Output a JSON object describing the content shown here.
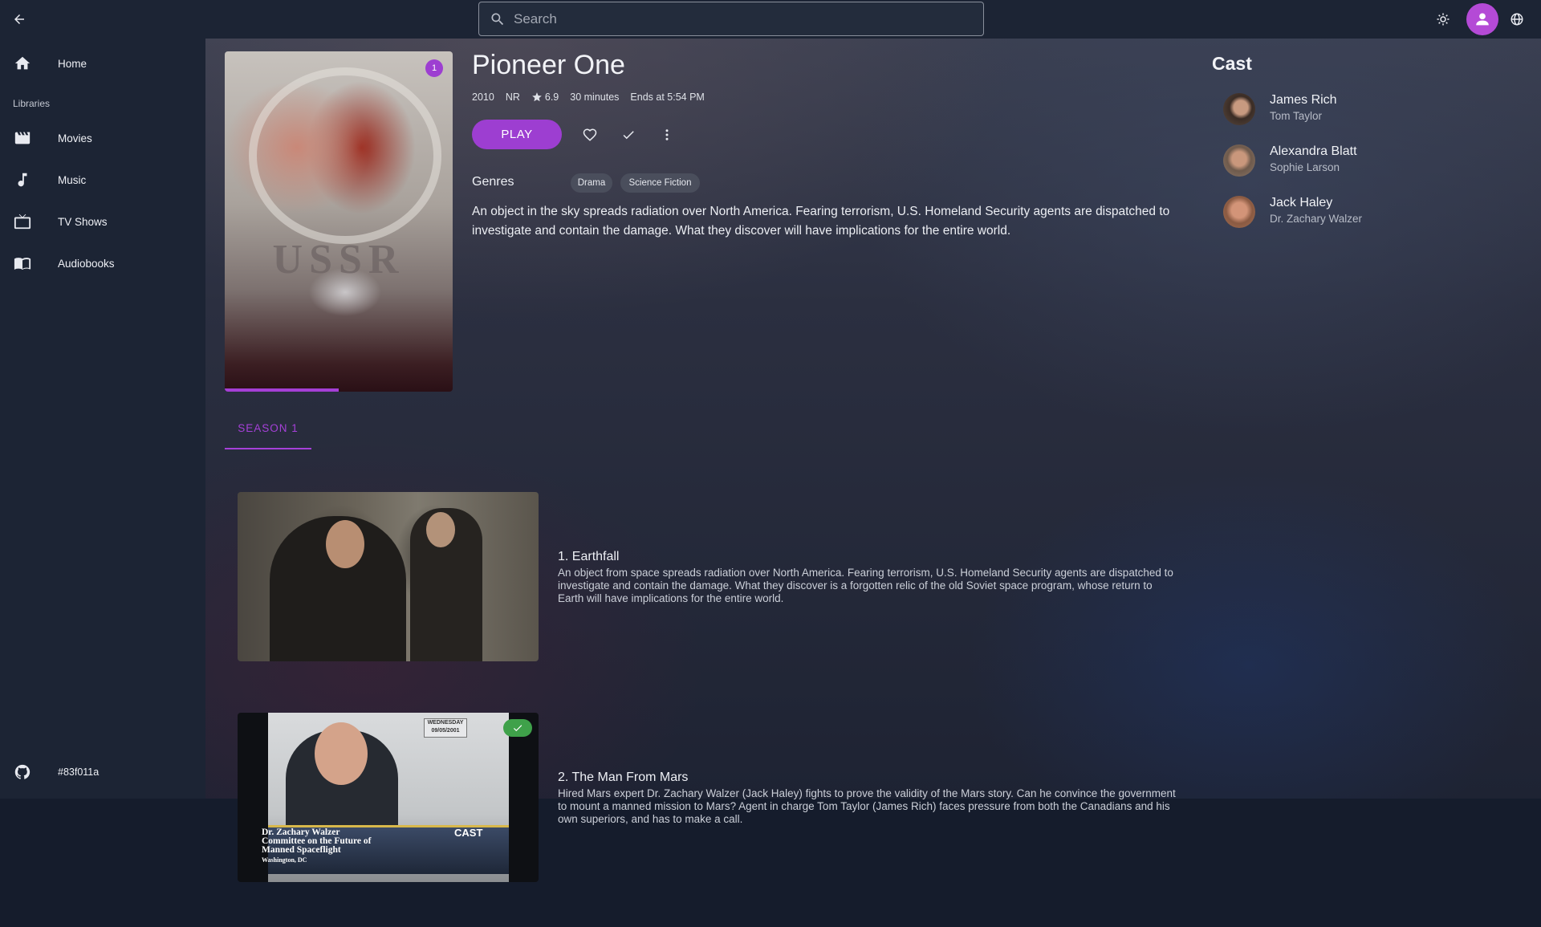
{
  "search": {
    "placeholder": "Search"
  },
  "sidebar": {
    "items": [
      {
        "label": "Home",
        "icon": "home-icon"
      },
      {
        "label": "Movies",
        "icon": "movie-icon"
      },
      {
        "label": "Music",
        "icon": "music-icon"
      },
      {
        "label": "TV Shows",
        "icon": "tv-icon"
      },
      {
        "label": "Audiobooks",
        "icon": "book-icon"
      }
    ],
    "libraries_label": "Libraries",
    "version": "#83f011a"
  },
  "item": {
    "title": "Pioneer One",
    "year": "2010",
    "rating": "NR",
    "community_rating": "6.9",
    "runtime": "30 minutes",
    "ends_at": "Ends at 5:54 PM",
    "unplayed_count": "1",
    "play_progress": 0.5,
    "play_label": "PLAY",
    "genres_label": "Genres",
    "genres": [
      "Drama",
      "Science Fiction"
    ],
    "overview": "An object in the sky spreads radiation over North America. Fearing terrorism, U.S. Homeland Security agents are dispatched to investigate and contain the damage. What they discover will have implications for the entire world.",
    "poster_text": "USSR"
  },
  "cast": {
    "title": "Cast",
    "people": [
      {
        "name": "James Rich",
        "role": "Tom Taylor"
      },
      {
        "name": "Alexandra Blatt",
        "role": "Sophie Larson"
      },
      {
        "name": "Jack Haley",
        "role": "Dr. Zachary Walzer"
      }
    ]
  },
  "seasons": {
    "active_tab": "SEASON 1"
  },
  "episodes": [
    {
      "title": "1. Earthfall",
      "overview": "An object from space spreads radiation over North America. Fearing terrorism, U.S. Homeland Security agents are dispatched to investigate and contain the damage. What they discover is a forgotten relic of the old Soviet space program, whose return to Earth will have implications for the entire world.",
      "watched": false
    },
    {
      "title": "2. The Man From Mars",
      "overview": "Hired Mars expert Dr. Zachary Walzer (Jack Haley) fights to prove the validity of the Mars story. Can he convince the government to mount a manned mission to Mars? Agent in charge Tom Taylor (James Rich) faces pressure from both the Canadians and his own superiors, and has to make a call.",
      "watched": true,
      "thumb_date_day": "WEDNESDAY",
      "thumb_date": "09/05/2001",
      "thumb_caption": "Dr. Zachary Walzer\nCommittee on the Future of\nManned Spaceflight",
      "thumb_location": "Washington, DC",
      "thumb_network": "CAST"
    }
  ],
  "colors": {
    "accent": "#9d3ed1",
    "watched": "#3fa14a",
    "sidebar_bg": "#1c2434"
  }
}
